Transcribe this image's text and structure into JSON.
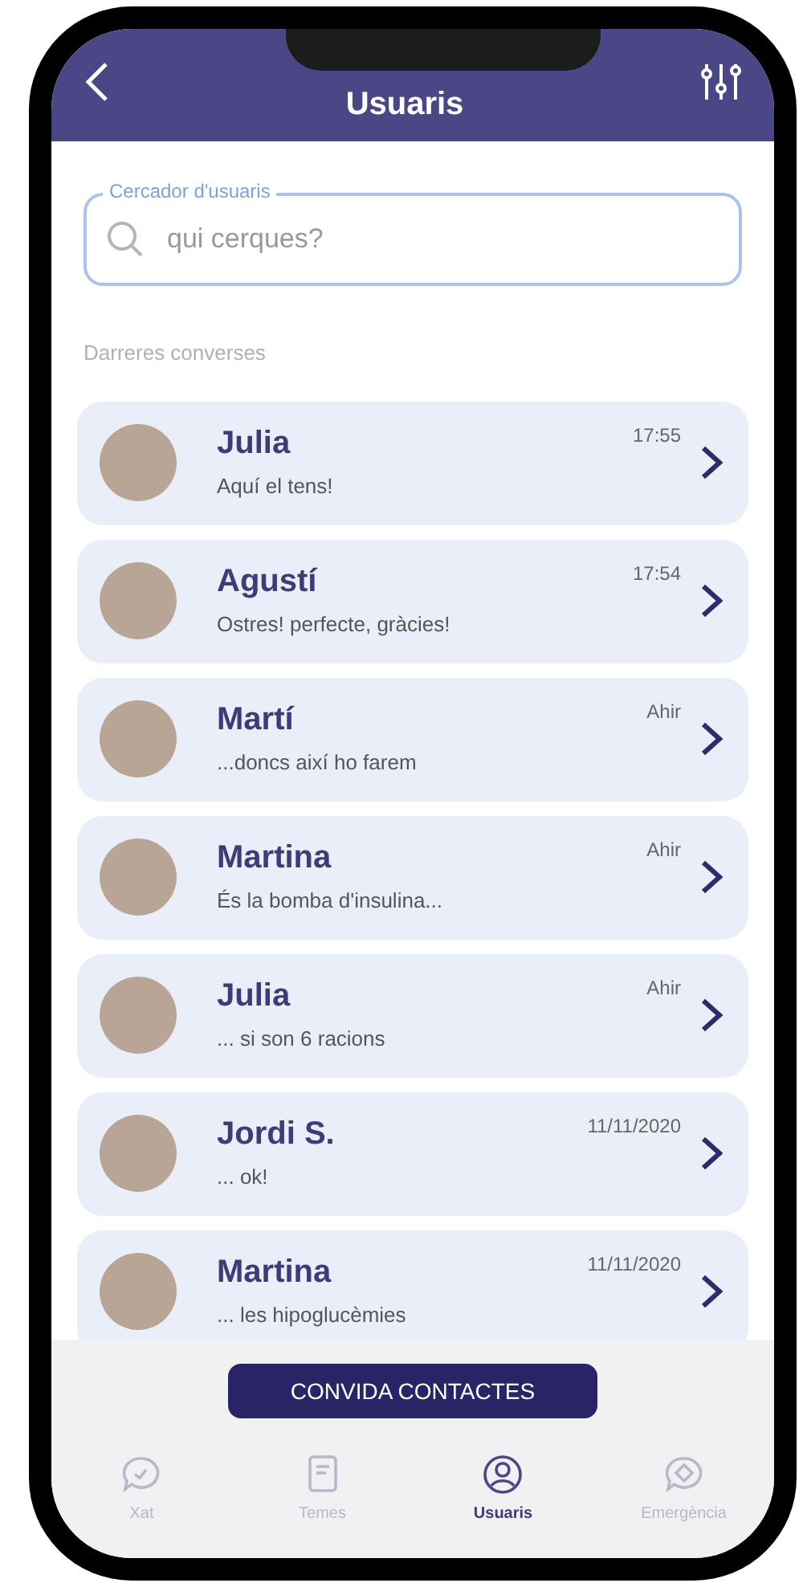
{
  "header": {
    "title": "Usuaris"
  },
  "search": {
    "label": "Cercador d'usuaris",
    "placeholder": "qui cerques?"
  },
  "section_title": "Darreres converses",
  "conversations": [
    {
      "name": "Julia",
      "message": "Aquí el tens!",
      "time": "17:55"
    },
    {
      "name": "Agustí",
      "message": "Ostres! perfecte, gràcies!",
      "time": "17:54"
    },
    {
      "name": "Martí",
      "message": "...doncs així ho farem",
      "time": "Ahir"
    },
    {
      "name": "Martina",
      "message": "És la bomba d'insulina...",
      "time": "Ahir"
    },
    {
      "name": "Julia",
      "message": "... si son 6 racions",
      "time": "Ahir"
    },
    {
      "name": "Jordi S.",
      "message": "... ok!",
      "time": "11/11/2020"
    },
    {
      "name": "Martina",
      "message": "... les hipoglucèmies",
      "time": "11/11/2020"
    }
  ],
  "invite_button": "CONVIDA CONTACTES",
  "tabs": [
    {
      "label": "Xat",
      "kind": "chat",
      "selected": false
    },
    {
      "label": "Temes",
      "kind": "topics",
      "selected": false
    },
    {
      "label": "Usuaris",
      "kind": "users",
      "selected": true
    },
    {
      "label": "Emergència",
      "kind": "emergency",
      "selected": false
    }
  ]
}
